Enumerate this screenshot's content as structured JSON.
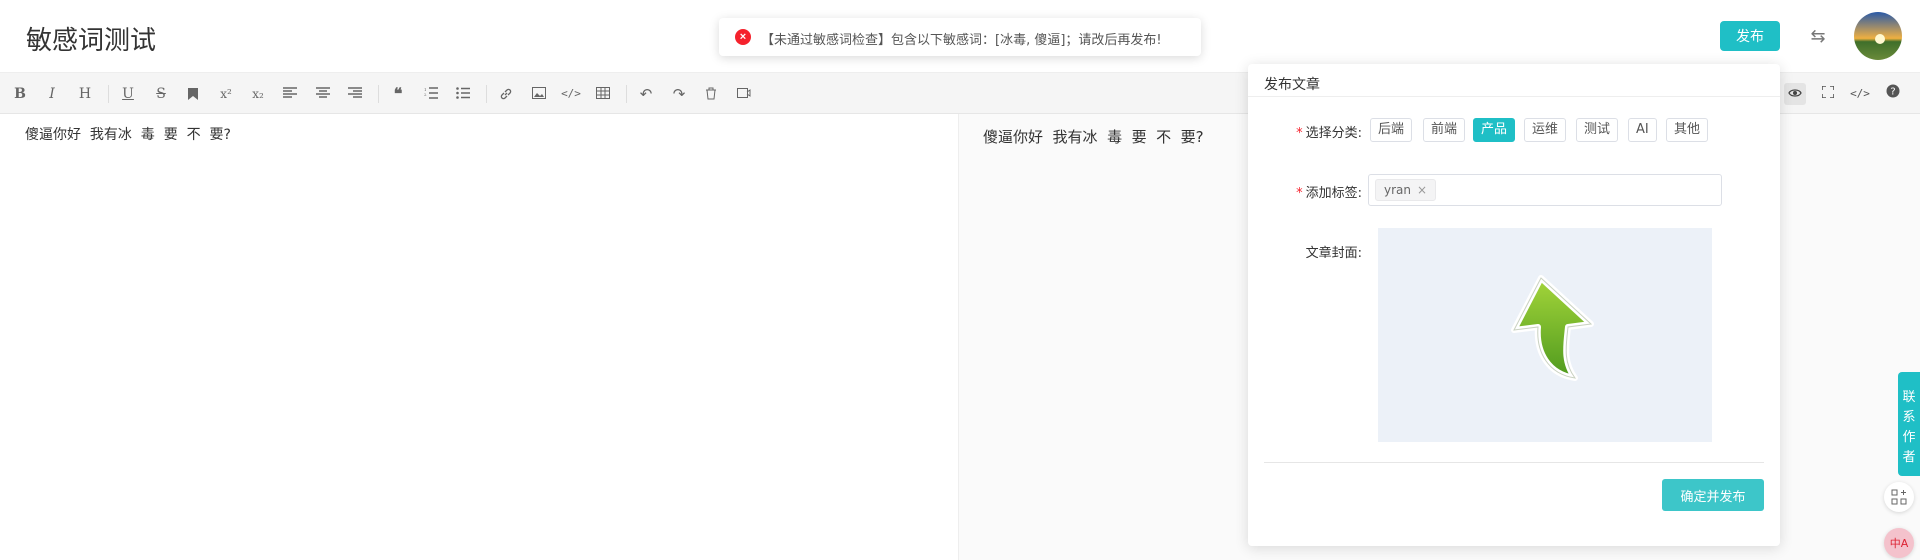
{
  "header": {
    "title": "敏感词测试",
    "publish_label": "发布",
    "swap_icon": "⇆"
  },
  "toast": {
    "icon": "×",
    "message": "【未通过敏感词检查】包含以下敏感词：[冰毒, 傻逼]；请改后再发布!"
  },
  "toolbar": {
    "items": [
      "B",
      "I",
      "H",
      "U",
      "S",
      "bookmark",
      "x²",
      "x₂",
      "align-left",
      "align-center",
      "align-right",
      "quote",
      "ordered-list",
      "unordered-list",
      "link",
      "image",
      "code",
      "table",
      "undo",
      "redo",
      "trash",
      "save"
    ]
  },
  "editor": {
    "content": "傻逼你好  我有冰  毒  要  不  要?"
  },
  "preview": {
    "content": "傻逼你好  我有冰  毒  要  不  要?"
  },
  "panel": {
    "title": "发布文章",
    "category_label": "选择分类:",
    "categories": [
      "后端",
      "前端",
      "产品",
      "运维",
      "测试",
      "AI",
      "其他"
    ],
    "active_category": "产品",
    "tags_label": "添加标签:",
    "tags": [
      "yran"
    ],
    "cover_label": "文章封面:",
    "confirm_label": "确定并发布",
    "required_mark": "*"
  },
  "sidebar": {
    "contact_label": "联系作者"
  },
  "colors": {
    "accent": "#1fbfc6",
    "error": "#f5222d"
  }
}
